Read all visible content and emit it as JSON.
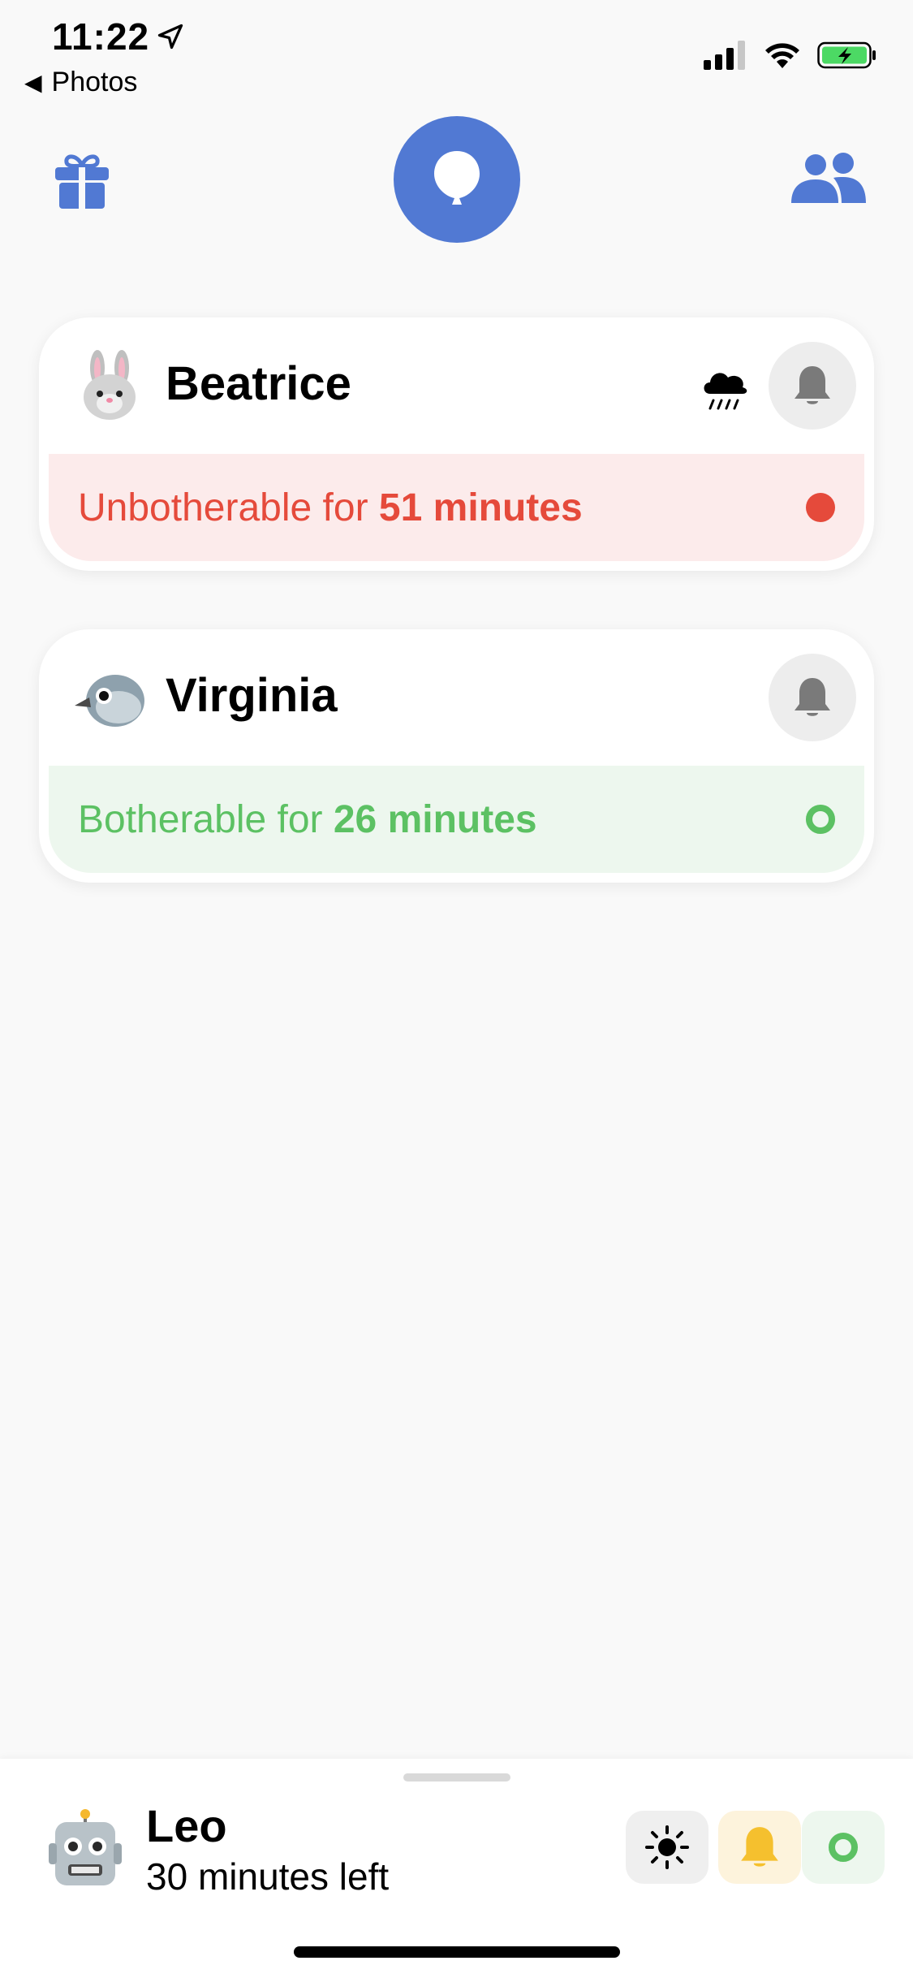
{
  "status_bar": {
    "time": "11:22",
    "back_label": "Photos"
  },
  "colors": {
    "accent": "#5179d3",
    "unbotherable": "#e54a3b",
    "botherable": "#5cc163"
  },
  "nav": {
    "left_icon": "gift-icon",
    "center_icon": "balloon-icon",
    "right_icon": "people-icon"
  },
  "contacts": [
    {
      "emoji_icon": "rabbit-face-icon",
      "name": "Beatrice",
      "weather_icon": "rain-cloud-icon",
      "status_prefix": "Unbotherable for ",
      "status_duration": "51 minutes",
      "status": "unbotherable"
    },
    {
      "emoji_icon": "bird-icon",
      "name": "Virginia",
      "status_prefix": "Botherable for ",
      "status_duration": "26 minutes",
      "status": "botherable"
    }
  ],
  "me": {
    "emoji_icon": "robot-icon",
    "name": "Leo",
    "time_left": "30 minutes left",
    "actions": [
      "sun-icon",
      "bell-icon",
      "ring-icon"
    ]
  }
}
